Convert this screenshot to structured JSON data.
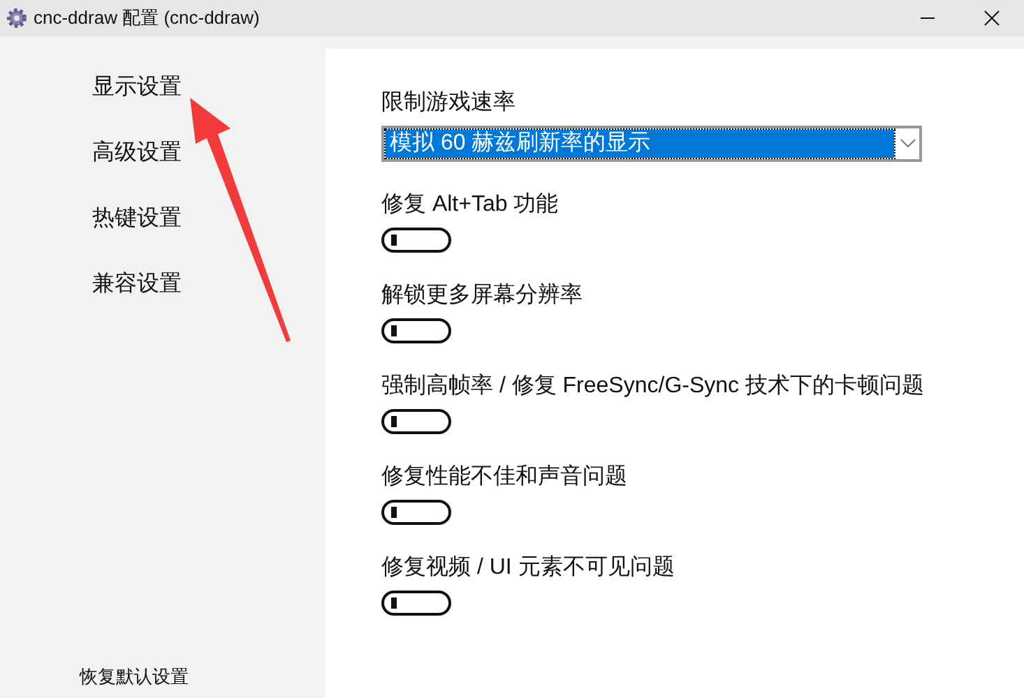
{
  "window": {
    "title": "cnc-ddraw 配置  (cnc-ddraw)"
  },
  "sidebar": {
    "items": [
      {
        "label": "显示设置"
      },
      {
        "label": "高级设置"
      },
      {
        "label": "热键设置"
      },
      {
        "label": "兼容设置"
      }
    ],
    "reset_link": "恢复默认设置"
  },
  "settings": [
    {
      "kind": "dropdown",
      "label": "限制游戏速率",
      "value": "模拟 60 赫兹刷新率的显示"
    },
    {
      "kind": "toggle",
      "label": "修复 Alt+Tab 功能",
      "on": false
    },
    {
      "kind": "toggle",
      "label": "解锁更多屏幕分辨率",
      "on": false
    },
    {
      "kind": "toggle",
      "label": "强制高帧率 / 修复 FreeSync/G-Sync 技术下的卡顿问题",
      "on": false
    },
    {
      "kind": "toggle",
      "label": "修复性能不佳和声音问题",
      "on": false
    },
    {
      "kind": "toggle",
      "label": "修复视频 / UI 元素不可见问题",
      "on": false
    }
  ]
}
